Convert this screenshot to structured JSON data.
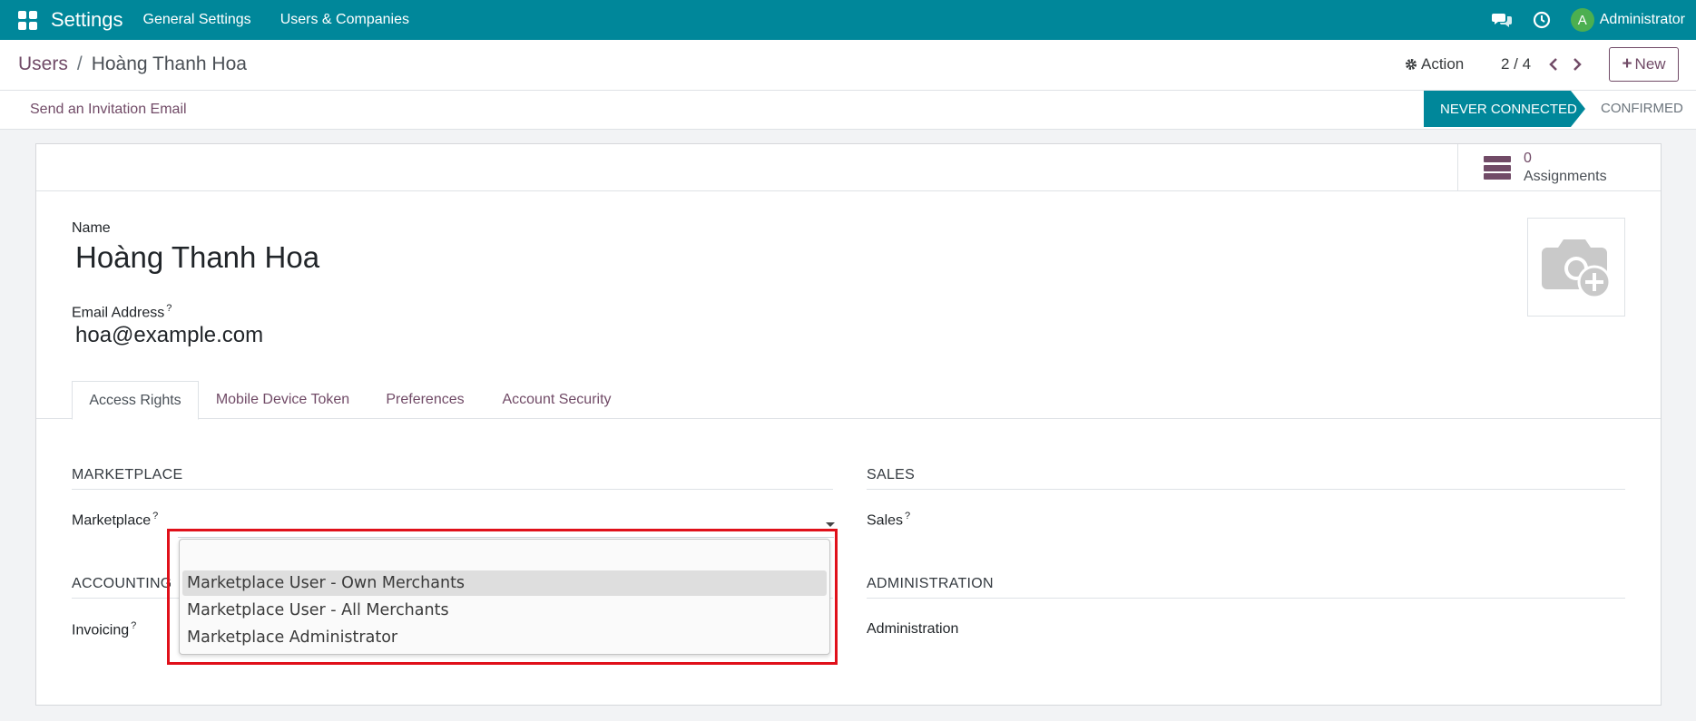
{
  "navbar": {
    "brand": "Settings",
    "menus": [
      "General Settings",
      "Users & Companies"
    ],
    "avatar_initial": "A",
    "user_name": "Administrator",
    "icons": [
      "apps-grid-icon",
      "chat-icon",
      "clock-icon"
    ],
    "bg_color": "#00879a"
  },
  "breadcrumb": {
    "parent": "Users",
    "separator": "/",
    "current": "Hoàng Thanh Hoa"
  },
  "controls": {
    "action_label": "Action",
    "pager": "2 / 4",
    "new_label": "New"
  },
  "statusbar": {
    "invite_label": "Send an Invitation Email",
    "stage_active": "NEVER CONNECTED",
    "stage_next": "CONFIRMED"
  },
  "stat_button": {
    "value": "0",
    "label": "Assignments"
  },
  "form": {
    "name_label": "Name",
    "name_value": "Hoàng Thanh Hoa",
    "email_label": "Email Address",
    "email_value": "hoa@example.com",
    "help_mark": "?"
  },
  "tabs": [
    "Access Rights",
    "Mobile Device Token",
    "Preferences",
    "Account Security"
  ],
  "active_tab": "Access Rights",
  "sections": {
    "marketplace_title": "MARKETPLACE",
    "marketplace_field": "Marketplace",
    "sales_title": "SALES",
    "sales_field": "Sales",
    "accounting_title": "ACCOUNTING",
    "invoicing_field": "Invoicing",
    "administration_title": "ADMINISTRATION",
    "administration_field": "Administration"
  },
  "dropdown": {
    "options": [
      "Marketplace User - Own Merchants",
      "Marketplace User - All Merchants",
      "Marketplace Administrator"
    ],
    "highlighted_index": 0,
    "highlight_color": "#e0101a"
  },
  "colors": {
    "primary": "#714b67",
    "teal": "#00879a"
  }
}
